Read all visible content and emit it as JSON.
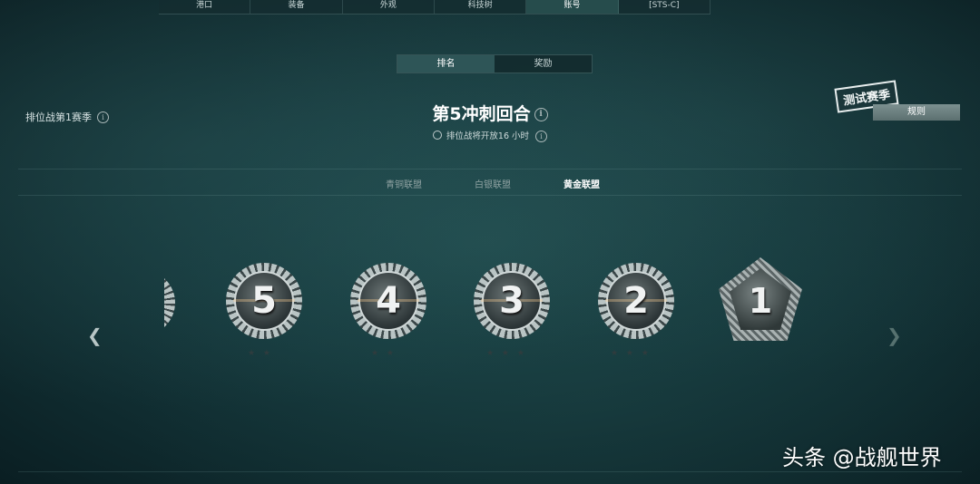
{
  "topnav": {
    "tabs": [
      {
        "label": "港口",
        "active": false
      },
      {
        "label": "装备",
        "active": false
      },
      {
        "label": "外观",
        "active": false
      },
      {
        "label": "科技树",
        "active": false
      },
      {
        "label": "账号",
        "active": true
      },
      {
        "label": "[STS-C]",
        "active": false
      }
    ]
  },
  "subtabs": [
    {
      "label": "排名",
      "active": true
    },
    {
      "label": "奖励",
      "active": false
    }
  ],
  "season_label": "排位战第1赛季",
  "round_title": "第5冲刺回合",
  "timer_text": "排位战将开放16 小时",
  "stamp_text": "测试赛季",
  "rules_label": "规则",
  "leagues": [
    {
      "label": "青铜联盟",
      "active": false
    },
    {
      "label": "白银联盟",
      "active": false
    },
    {
      "label": "黄金联盟",
      "active": true
    }
  ],
  "ranks": [
    "5",
    "4",
    "3",
    "2",
    "1"
  ],
  "rank_stars": [
    "★ ★",
    "★ ★",
    "★ ★ ★",
    "★ ★ ★"
  ],
  "icons": {
    "prev": "chevron-left-icon",
    "next": "chevron-right-icon",
    "info": "info-icon",
    "clock": "clock-icon"
  },
  "watermark": "头条 @战舰世界"
}
